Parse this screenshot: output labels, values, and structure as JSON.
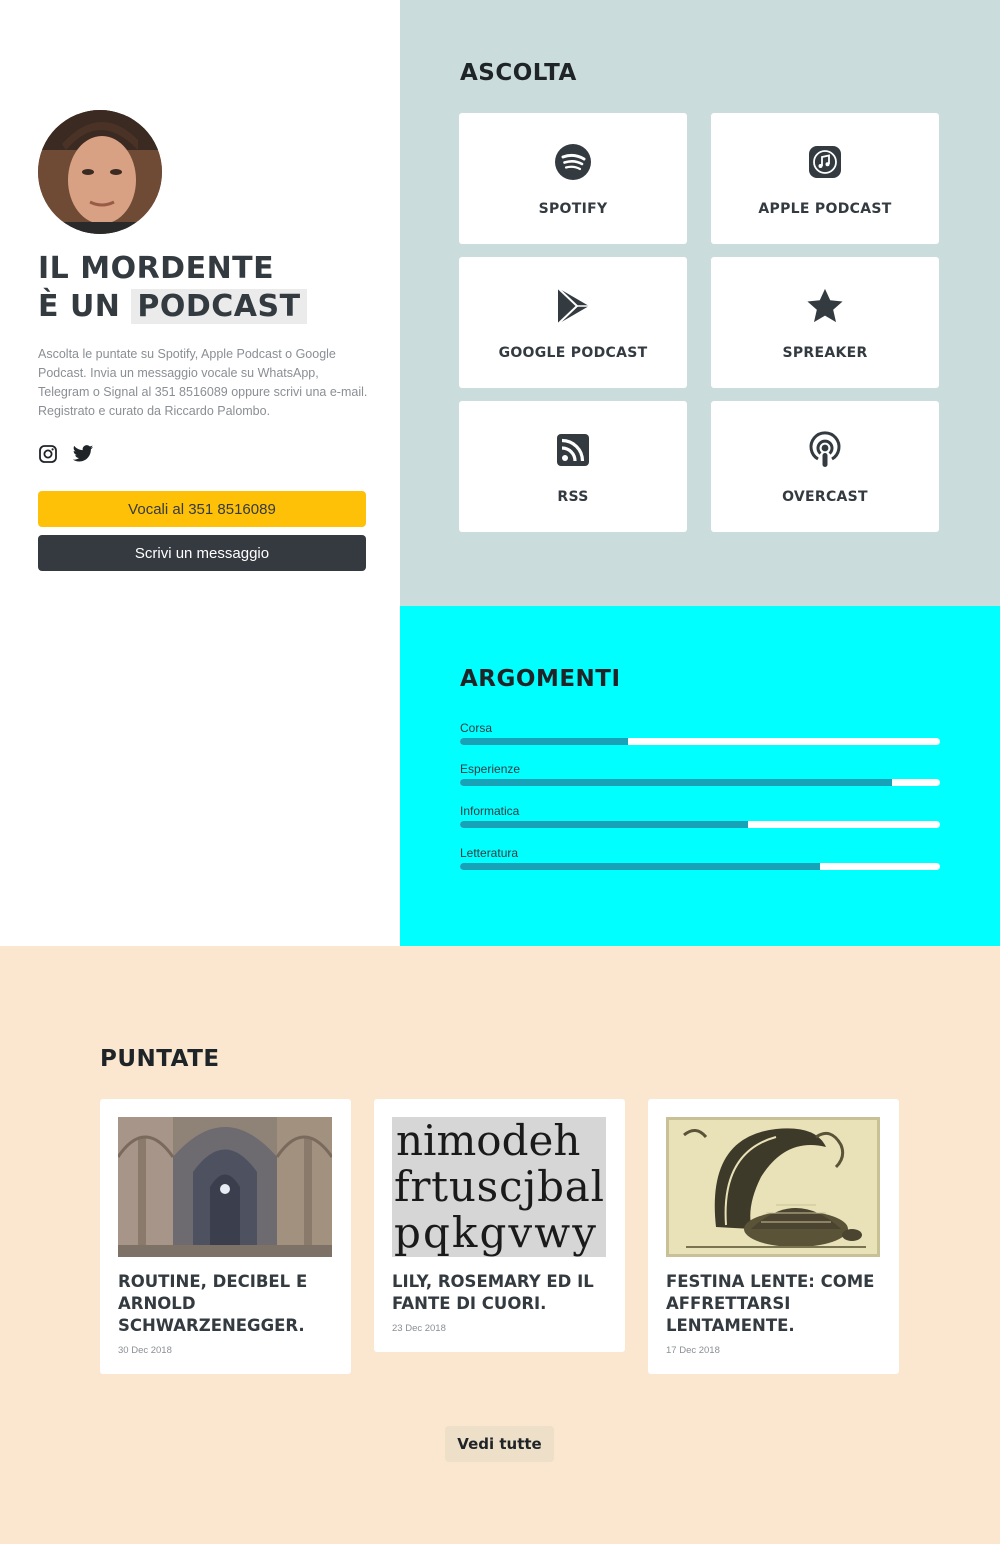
{
  "profile": {
    "title_line1": "IL MORDENTE",
    "title_line2_prefix": "È UN",
    "title_line2_highlight": "PODCAST",
    "description": "Ascolta le puntate su Spotify, Apple Podcast o Google Podcast. Invia un messaggio vocale su WhatsApp, Telegram o Signal al 351 8516089 oppure scrivi una e-mail. Registrato e curato da Riccardo Palombo.",
    "socials": [
      "instagram-icon",
      "twitter-icon"
    ],
    "btn_vocali": "Vocali al 351 8516089",
    "btn_messaggio": "Scrivi un messaggio"
  },
  "ascolta": {
    "title": "ASCOLTA",
    "platforms": [
      {
        "label": "SPOTIFY",
        "icon": "spotify-icon"
      },
      {
        "label": "APPLE PODCAST",
        "icon": "apple-podcast-icon"
      },
      {
        "label": "GOOGLE PODCAST",
        "icon": "google-play-icon"
      },
      {
        "label": "SPREAKER",
        "icon": "star-icon"
      },
      {
        "label": "RSS",
        "icon": "rss-icon"
      },
      {
        "label": "OVERCAST",
        "icon": "podcast-icon"
      }
    ]
  },
  "argomenti": {
    "title": "ARGOMENTI",
    "topics": [
      {
        "label": "Corsa",
        "value": 0.35
      },
      {
        "label": "Esperienze",
        "value": 0.9
      },
      {
        "label": "Informatica",
        "value": 0.6
      },
      {
        "label": "Letteratura",
        "value": 0.75
      }
    ]
  },
  "puntate": {
    "title": "PUNTATE",
    "episodes": [
      {
        "title": "ROUTINE, DECIBEL E ARNOLD SCHWARZENEGGER.",
        "date": "30 Dec 2018",
        "image": "cathedral-photo"
      },
      {
        "title": "LILY, ROSEMARY ED IL FANTE DI CUORI.",
        "date": "23 Dec 2018",
        "image": "typeface-specimen",
        "image_text": [
          "nimodeh",
          "frtuscjbal",
          "pqkgvwy"
        ]
      },
      {
        "title": "FESTINA LENTE: COME AFFRETTARSI LENTAMENTE.",
        "date": "17 Dec 2018",
        "image": "turtle-sail-engraving"
      }
    ],
    "see_all": "Vedi tutte"
  },
  "colors": {
    "accent_yellow": "#ffc107",
    "dark": "#343a40",
    "ascolta_bg": "#cadcdc",
    "argomenti_bg": "#00ffff",
    "bar_fill": "#17a2b8",
    "puntate_bg": "#fbe7d0"
  }
}
